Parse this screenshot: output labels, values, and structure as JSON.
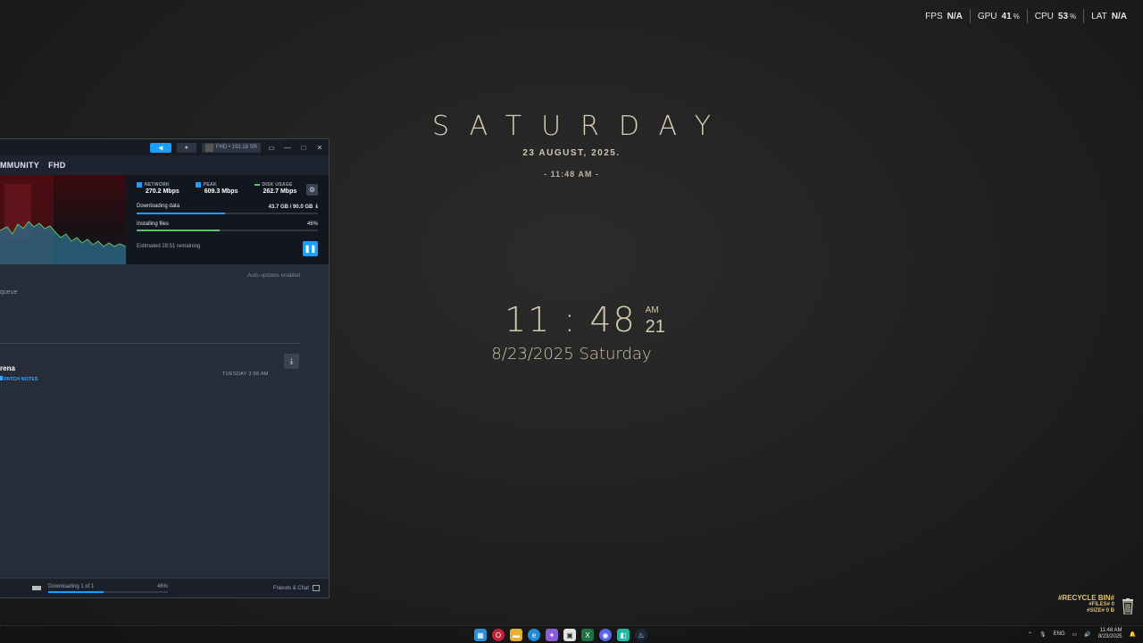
{
  "perf": [
    {
      "label": "FPS",
      "value": "N/A",
      "unit": ""
    },
    {
      "label": "GPU",
      "value": "41",
      "unit": "%"
    },
    {
      "label": "CPU",
      "value": "53",
      "unit": "%"
    },
    {
      "label": "LAT",
      "value": "N/A",
      "unit": ""
    }
  ],
  "widget": {
    "dayname": "SATURDAY",
    "fulldate": "23 AUGUST, 2025.",
    "smalltime": "- 11:48 AM -",
    "clock_hm": "11 : 48",
    "clock_ampm": "AM",
    "clock_sec": "21",
    "clock_date": "8/23/2025 Saturday"
  },
  "steam": {
    "account": "FHD • 192.18 SR",
    "nav": [
      "MMUNITY",
      "FHD"
    ],
    "stats": [
      {
        "label": "NETWORK",
        "value": "270.2 Mbps",
        "color": "#1a9fff"
      },
      {
        "label": "PEAK",
        "value": "609.3 Mbps",
        "color": "#1a9fff"
      },
      {
        "label": "DISK USAGE",
        "value": "262.7 Mbps",
        "color": "#5ec269"
      }
    ],
    "downloading_label": "Downloading data",
    "downloading_value": "43.7 GB / 90.0 GB",
    "downloading_fraction": 0.49,
    "installing_label": "Installing files",
    "installing_value": "46%",
    "installing_fraction": 0.46,
    "remaining": "Estimated 28:51 remaining",
    "auto_updates": "Auto-updates enabled",
    "queue_label": "queue",
    "game_name": "rena",
    "patch_notes": "PATCH NOTES",
    "schedule": "TUESDAY 3:58 AM",
    "footer_downloading": "Downloading 1 of 1",
    "footer_pct": "46%",
    "footer_fraction": 0.46,
    "friends": "Friends & Chat"
  },
  "recycle": {
    "title": "#RECYCLE BIN#",
    "files": "#FILES# 0",
    "size": "#SIZE# 0 B"
  },
  "taskbar": {
    "lang": "ENG",
    "time": "11:48 AM",
    "date": "8/23/2025"
  }
}
